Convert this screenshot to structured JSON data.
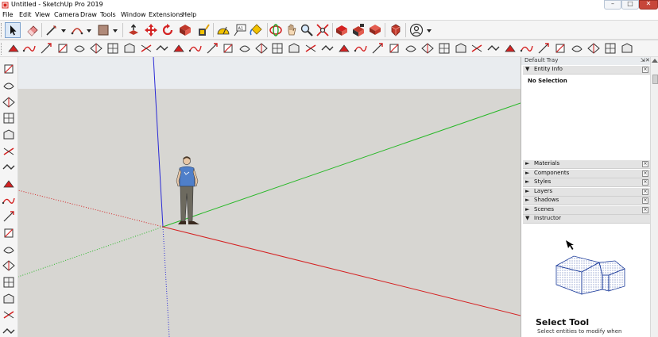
{
  "window": {
    "title": "Untitled - SketchUp Pro 2019",
    "controls": {
      "minimize": "–",
      "maximize": "□",
      "close": "✕"
    }
  },
  "menu": [
    "File",
    "Edit",
    "View",
    "Camera",
    "Draw",
    "Tools",
    "Window",
    "Extensions",
    "Help"
  ],
  "toolbar1": {
    "icons": [
      "select-icon",
      "eraser-icon",
      "line-icon",
      "arc-icon",
      "rectangle-icon",
      "push-pull-icon",
      "move-icon",
      "rotate-icon",
      "scale-icon",
      "tape-measure-icon",
      "text-icon",
      "paint-bucket-icon",
      "orbit-icon",
      "pan-icon",
      "zoom-icon",
      "zoom-extents-icon",
      "3d-warehouse-icon",
      "extension-warehouse-icon",
      "layout-icon",
      "ruby-icon",
      "user-icon"
    ]
  },
  "toolbar2": {
    "icons": [
      "sandbox-from-contours-icon",
      "sandbox-from-scratch-icon",
      "smoove-icon",
      "stamp-icon",
      "drape-icon",
      "add-detail-icon",
      "flip-edge-icon",
      "intersect-icon",
      "outer-shell-icon",
      "union-icon",
      "subtract-icon",
      "trim-icon",
      "split-icon",
      "section-plane-icon",
      "section-display-icon",
      "section-cut-icon",
      "warehouse-share-icon",
      "component-icon",
      "group-icon",
      "solid-inspector-icon"
    ]
  },
  "left_toolbar": {
    "icons": [
      "polygon-icon",
      "pie-icon",
      "freehand-icon",
      "follow-me-icon",
      "offset-icon",
      "solid-tools-icon",
      "protractor-icon",
      "axes-icon",
      "dimension-icon",
      "3d-text-icon",
      "position-camera-icon",
      "walk-icon",
      "look-around-icon",
      "section-icon",
      "zoom-window-icon",
      "previous-view-icon",
      "next-view-icon"
    ]
  },
  "tray": {
    "title": "Default Tray",
    "pin": "⇲",
    "close": "✕",
    "entity_info": {
      "label": "Entity Info",
      "arrow": "▼",
      "close": "×",
      "body": "No Selection"
    },
    "panels": [
      {
        "label": "Materials",
        "arrow": "►",
        "close": "×"
      },
      {
        "label": "Components",
        "arrow": "►",
        "close": "×"
      },
      {
        "label": "Styles",
        "arrow": "►",
        "close": "×"
      },
      {
        "label": "Layers",
        "arrow": "►",
        "close": "×"
      },
      {
        "label": "Shadows",
        "arrow": "►",
        "close": "×"
      },
      {
        "label": "Scenes",
        "arrow": "►",
        "close": "×"
      }
    ],
    "instructor": {
      "label": "Instructor",
      "arrow": "▼",
      "title": "Select Tool",
      "description": "Select entities to modify when"
    }
  },
  "colors": {
    "sky": "#e9ecef",
    "ground": "#d7d6d2",
    "axis_blue": "#2a2ad6",
    "axis_green": "#28b828",
    "axis_red": "#d42222"
  }
}
